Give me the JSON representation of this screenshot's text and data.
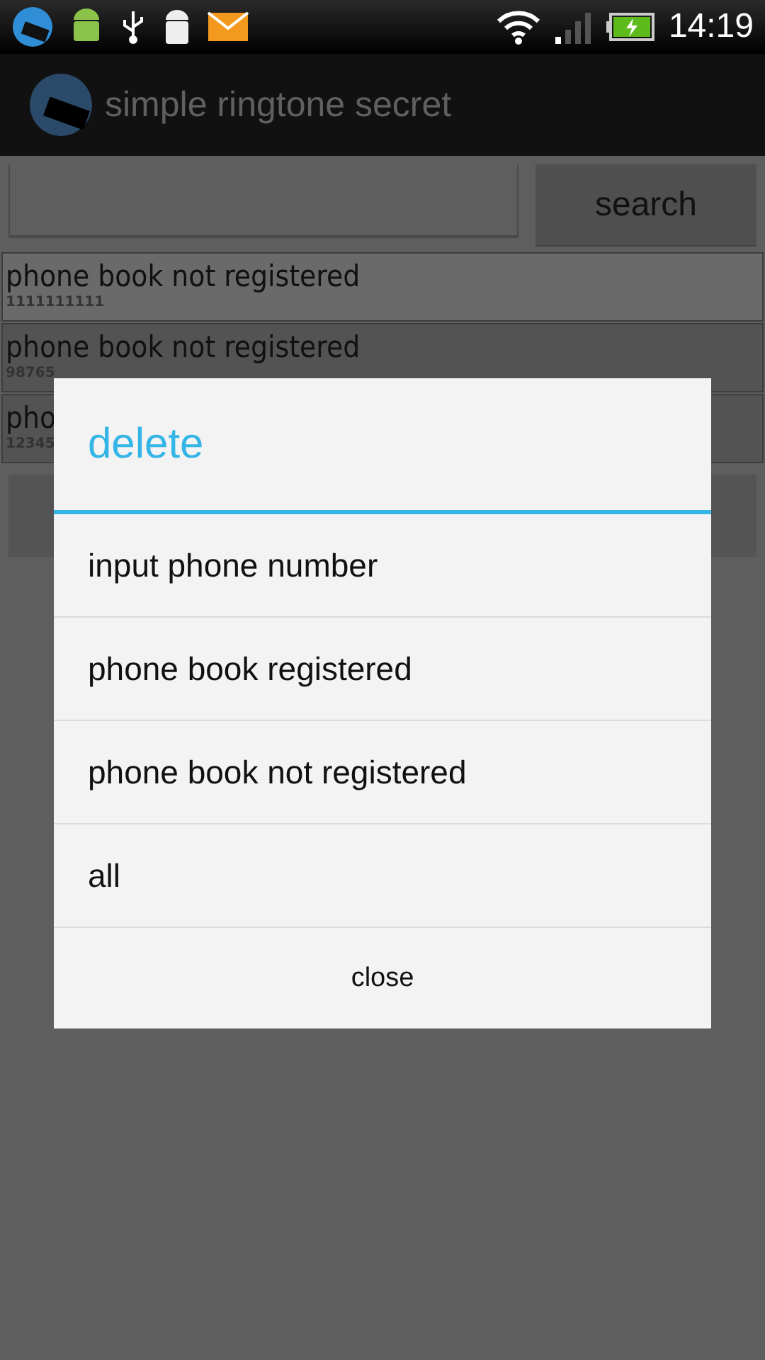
{
  "status_bar": {
    "time": "14:19"
  },
  "action_bar": {
    "title": "simple ringtone secret"
  },
  "search": {
    "button": "search"
  },
  "list": [
    {
      "title": "phone book not registered",
      "number": "1111111111",
      "selected": true
    },
    {
      "title": "phone book not registered",
      "number": "98765",
      "selected": false
    },
    {
      "title": "pho",
      "number": "12345",
      "selected": false
    }
  ],
  "dialog": {
    "title": "delete",
    "items": [
      "input phone number",
      "phone book registered",
      "phone book not registered",
      "all"
    ],
    "close": "close"
  }
}
